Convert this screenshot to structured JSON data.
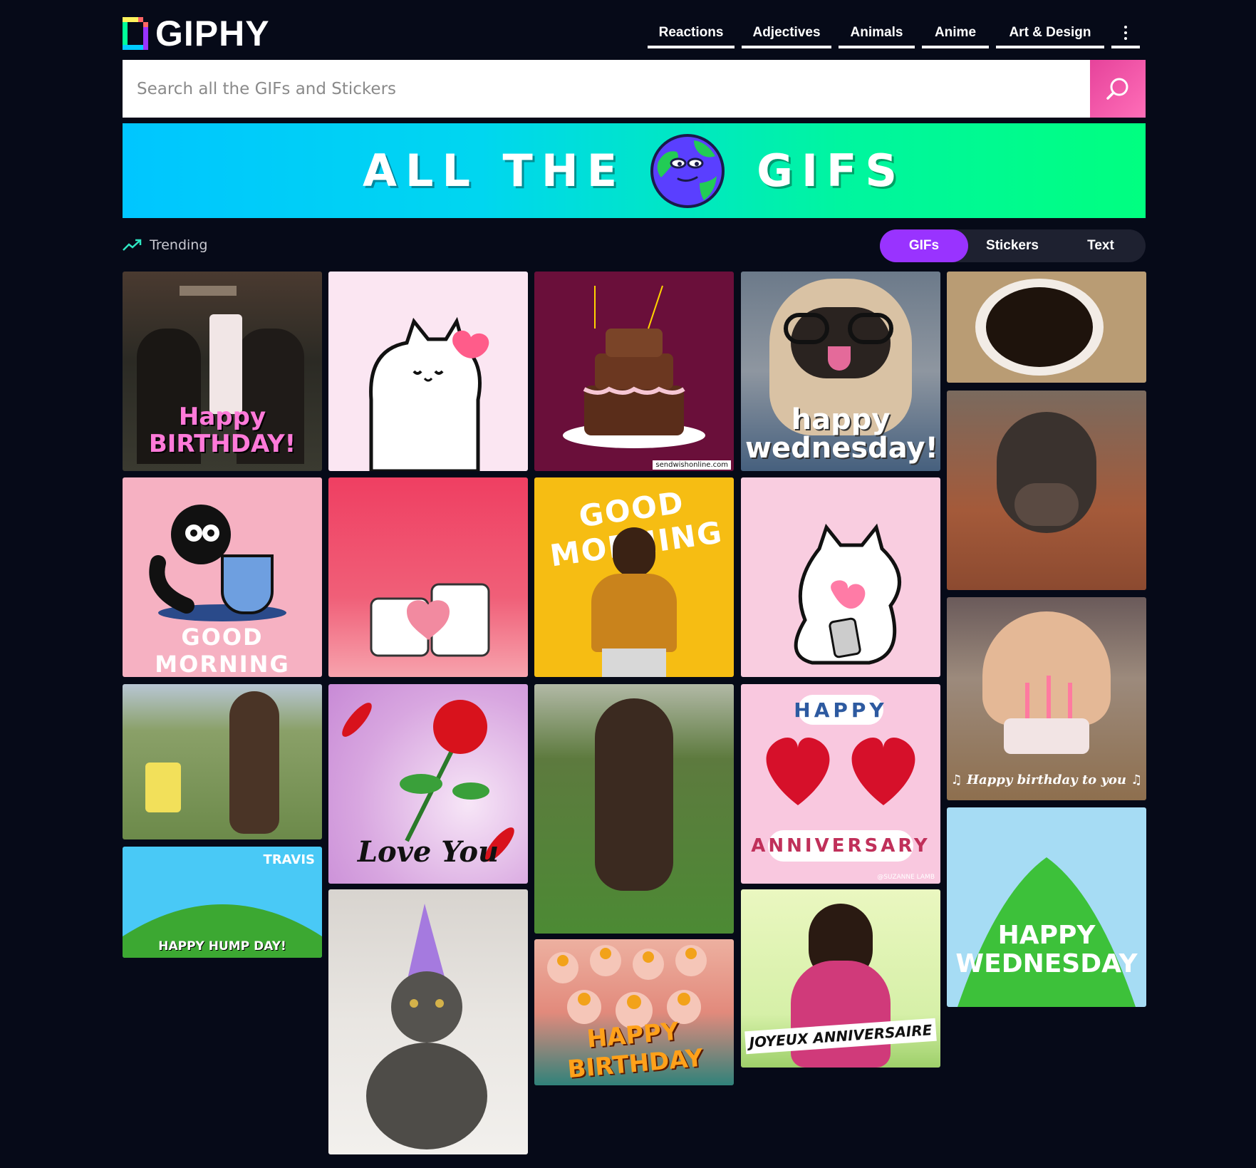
{
  "brand": {
    "name": "GIPHY"
  },
  "nav": {
    "items": [
      {
        "label": "Reactions"
      },
      {
        "label": "Adjectives"
      },
      {
        "label": "Animals"
      },
      {
        "label": "Anime"
      },
      {
        "label": "Art & Design"
      }
    ],
    "more_icon": "vertical-dots-icon"
  },
  "search": {
    "placeholder": "Search all the GIFs and Stickers",
    "value": "",
    "icon": "search-icon"
  },
  "banner": {
    "left_text": "ALL THE",
    "right_text": "GIFS"
  },
  "trending": {
    "label": "Trending",
    "icon": "trending-up-icon"
  },
  "toggle": {
    "options": [
      "GIFs",
      "Stickers",
      "Text"
    ],
    "selected": "GIFs"
  },
  "gifs": {
    "birthday_bakery": "Happy BIRTHDAY!",
    "pug": "happy wednesday!",
    "cake_watermark": "sendwishonline.com",
    "good_morning_cat": "GOOD MORNING",
    "good_morning_woman": "GOOD MORNING",
    "rose": "Love You",
    "anniversary_top": "HAPPY",
    "anniversary_bottom": "ANNIVERSARY",
    "anniversary_credit": "@SUZANNE LAMB",
    "birthday_cat_song": "♫ Happy birthday to you ♫",
    "hump_day": "HAPPY HUMP DAY!",
    "hump_day_brand": "TRAVIS",
    "cupcakes": "HAPPY BIRTHDAY",
    "joyeux": "JOYEUX ANNIVERSAIRE",
    "happy_wednesday": "HAPPY WEDNESDAY"
  },
  "colors": {
    "background": "#060a18",
    "accent_pink": "#e6439b",
    "accent_purple": "#9933ff",
    "banner_start": "#00c6ff",
    "banner_end": "#00ff80"
  }
}
